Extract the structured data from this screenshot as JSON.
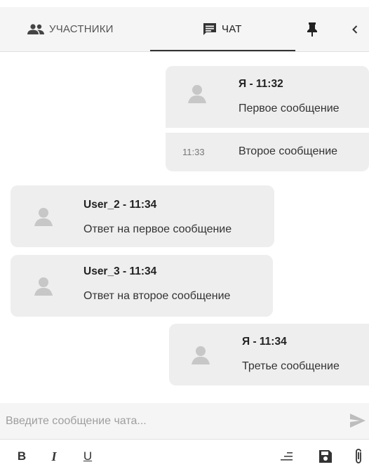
{
  "tabs": {
    "participants": {
      "label": "УЧАСТНИКИ",
      "icon": "people-icon"
    },
    "chat": {
      "label": "ЧАТ",
      "icon": "chat-bubble-icon"
    },
    "pin": {
      "icon": "pin-icon"
    },
    "collapse": {
      "icon": "chevron-left-icon"
    }
  },
  "messages": [
    {
      "author": "Я - 11:32",
      "text": "Первое сообщение",
      "own": true
    },
    {
      "time": "11:33",
      "text": "Второе сообщение",
      "own": true,
      "continuation": true
    },
    {
      "author": "User_2 - 11:34",
      "text": "Ответ на первое сообщение",
      "own": false
    },
    {
      "author": "User_3 - 11:34",
      "text": "Ответ на второе сообщение",
      "own": false
    },
    {
      "author": "Я - 11:34",
      "text": "Третье сообщение",
      "own": true
    }
  ],
  "composer": {
    "placeholder": "Введите сообщение чата...",
    "value": "",
    "send_icon": "send-icon"
  },
  "toolbar": {
    "bold": "B",
    "italic": "I",
    "underline": "U",
    "icons": [
      "bold-icon",
      "italic-icon",
      "underline-icon",
      "clear-format-icon",
      "save-icon",
      "attach-icon"
    ]
  },
  "colors": {
    "bubble": "#eeeeee",
    "header_bg": "#f5f5f5",
    "avatar": "#c7c7c7",
    "placeholder": "#9e9e9e"
  }
}
